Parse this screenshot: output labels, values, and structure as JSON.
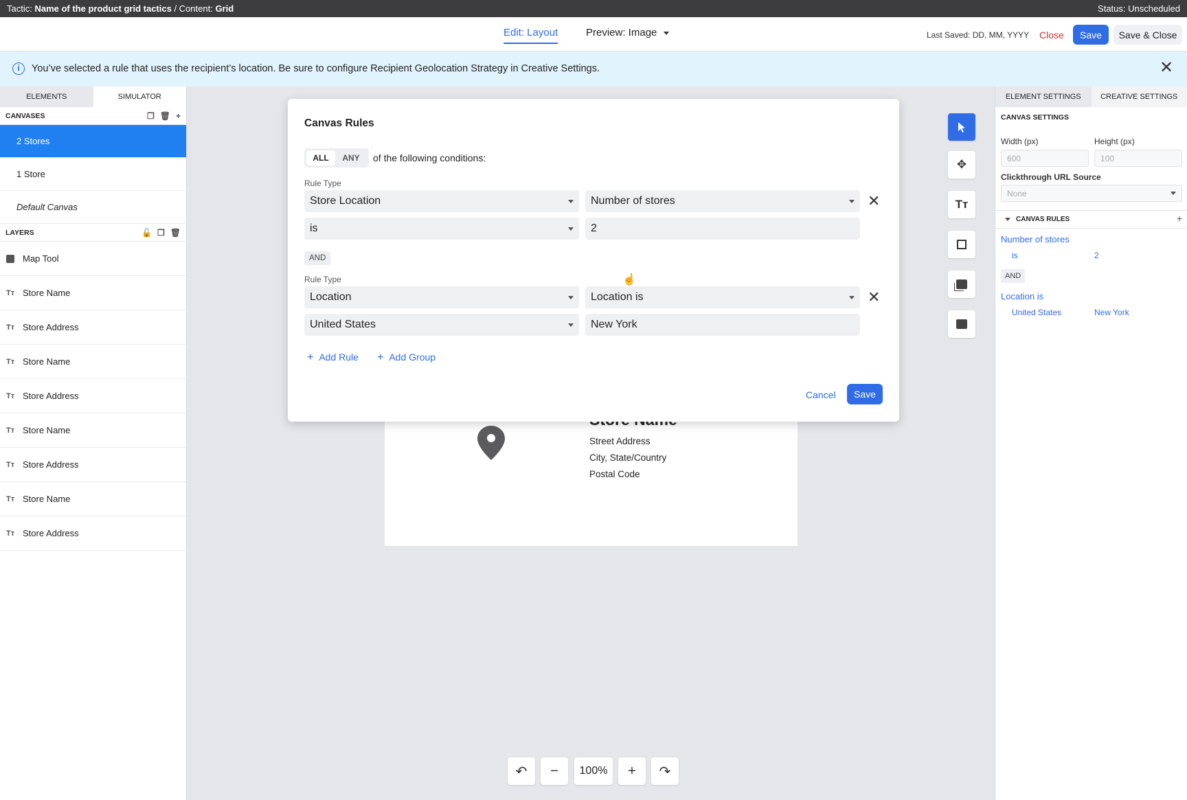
{
  "topbar": {
    "tactic_label": "Tactic: ",
    "tactic_name": "Name of the product grid tactics",
    "content_label": " / Content: ",
    "content_name": "Grid",
    "status": "Status: Unscheduled"
  },
  "header": {
    "edit_tab": "Edit: Layout",
    "preview_tab": "Preview: Image",
    "last_saved": "Last Saved: DD, MM, YYYY",
    "close": "Close",
    "save": "Save",
    "save_close": "Save & Close"
  },
  "banner": {
    "text": "You’ve selected a rule that uses the recipient’s location. Be sure to configure Recipient Geolocation Strategy in Creative Settings."
  },
  "left_panel": {
    "tabs": [
      "ELEMENTS",
      "SIMULATOR"
    ],
    "canvases_title": "CANVASES",
    "canvases": [
      "2 Stores",
      "1 Store",
      "Default Canvas"
    ],
    "layers_title": "LAYERS",
    "layers": [
      {
        "label": "Map Tool",
        "icon": "image-icon"
      },
      {
        "label": "Store Name",
        "icon": "text-icon"
      },
      {
        "label": "Store Address",
        "icon": "text-icon"
      },
      {
        "label": "Store Name",
        "icon": "text-icon"
      },
      {
        "label": "Store Address",
        "icon": "text-icon"
      },
      {
        "label": "Store Name",
        "icon": "text-icon"
      },
      {
        "label": "Store Address",
        "icon": "text-icon"
      },
      {
        "label": "Store Name",
        "icon": "text-icon"
      },
      {
        "label": "Store Address",
        "icon": "text-icon"
      }
    ]
  },
  "canvas": {
    "store_name": "Store Name",
    "street": "Street Address",
    "city": "City, State/Country",
    "postal": "Postal Code",
    "zoom": "100%"
  },
  "right_panel": {
    "tabs": [
      "ELEMENT SETTINGS",
      "CREATIVE SETTINGS"
    ],
    "section": "CANVAS SETTINGS",
    "width_label": "Width (px)",
    "width_value": "600",
    "height_label": "Height (px)",
    "height_value": "100",
    "clickthrough_label": "Clickthrough URL Source",
    "clickthrough_value": "None",
    "rules_title": "CANVAS RULES",
    "rule1_name": "Number of stores",
    "rule1_op": "is",
    "rule1_val": "2",
    "and": "AND",
    "rule2_name": "Location is",
    "rule2_country": "United States",
    "rule2_city": "New York"
  },
  "modal": {
    "title": "Canvas Rules",
    "all": "ALL",
    "any": "ANY",
    "conditions": "of the following conditions:",
    "rule_type_label": "Rule Type",
    "rule1": {
      "type": "Store Location",
      "attribute": "Number of stores",
      "operator": "is",
      "value": "2"
    },
    "and": "AND",
    "rule2": {
      "type": "Location",
      "attribute": "Location is",
      "country": "United States",
      "city": "New York"
    },
    "add_rule": "Add Rule",
    "add_group": "Add Group",
    "cancel": "Cancel",
    "save": "Save"
  },
  "colors": {
    "accent": "#2f6ce5",
    "selected": "#2180ef",
    "danger": "#d63030",
    "banner": "#e1f3fc"
  }
}
